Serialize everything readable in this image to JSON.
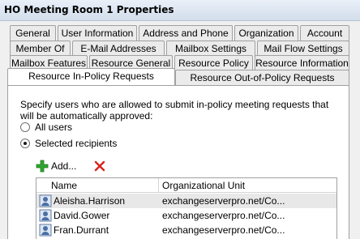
{
  "window": {
    "title": "HO Meeting Room 1 Properties"
  },
  "tabs": {
    "row1": [
      "General",
      "User Information",
      "Address and Phone",
      "Organization",
      "Account"
    ],
    "row2": [
      "Member Of",
      "E-Mail Addresses",
      "Mailbox Settings",
      "Mail Flow Settings"
    ],
    "row3": [
      "Mailbox Features",
      "Resource General",
      "Resource Policy",
      "Resource Information"
    ],
    "row4": [
      "Resource In-Policy Requests",
      "Resource Out-of-Policy Requests"
    ],
    "active": "Resource In-Policy Requests"
  },
  "panel": {
    "description": "Specify users who are allowed to submit in-policy meeting requests that will be automatically approved:",
    "options": [
      {
        "label": "All users",
        "selected": false
      },
      {
        "label": "Selected recipients",
        "selected": true
      }
    ],
    "toolbar": {
      "add_label": "Add...",
      "add_icon": "green-plus-icon",
      "remove_icon": "red-x-icon"
    },
    "grid": {
      "columns": [
        "Name",
        "Organizational Unit"
      ],
      "rows": [
        {
          "name": "Aleisha.Harrison",
          "ou": "exchangeserverpro.net/Co...",
          "selected": true
        },
        {
          "name": "David.Gower",
          "ou": "exchangeserverpro.net/Co...",
          "selected": false
        },
        {
          "name": "Fran.Durrant",
          "ou": "exchangeserverpro.net/Co...",
          "selected": false
        }
      ]
    }
  },
  "colors": {
    "accent_plus": "#2fa52f",
    "remove_x": "#d9241c",
    "selection": "#e8e8e8"
  }
}
